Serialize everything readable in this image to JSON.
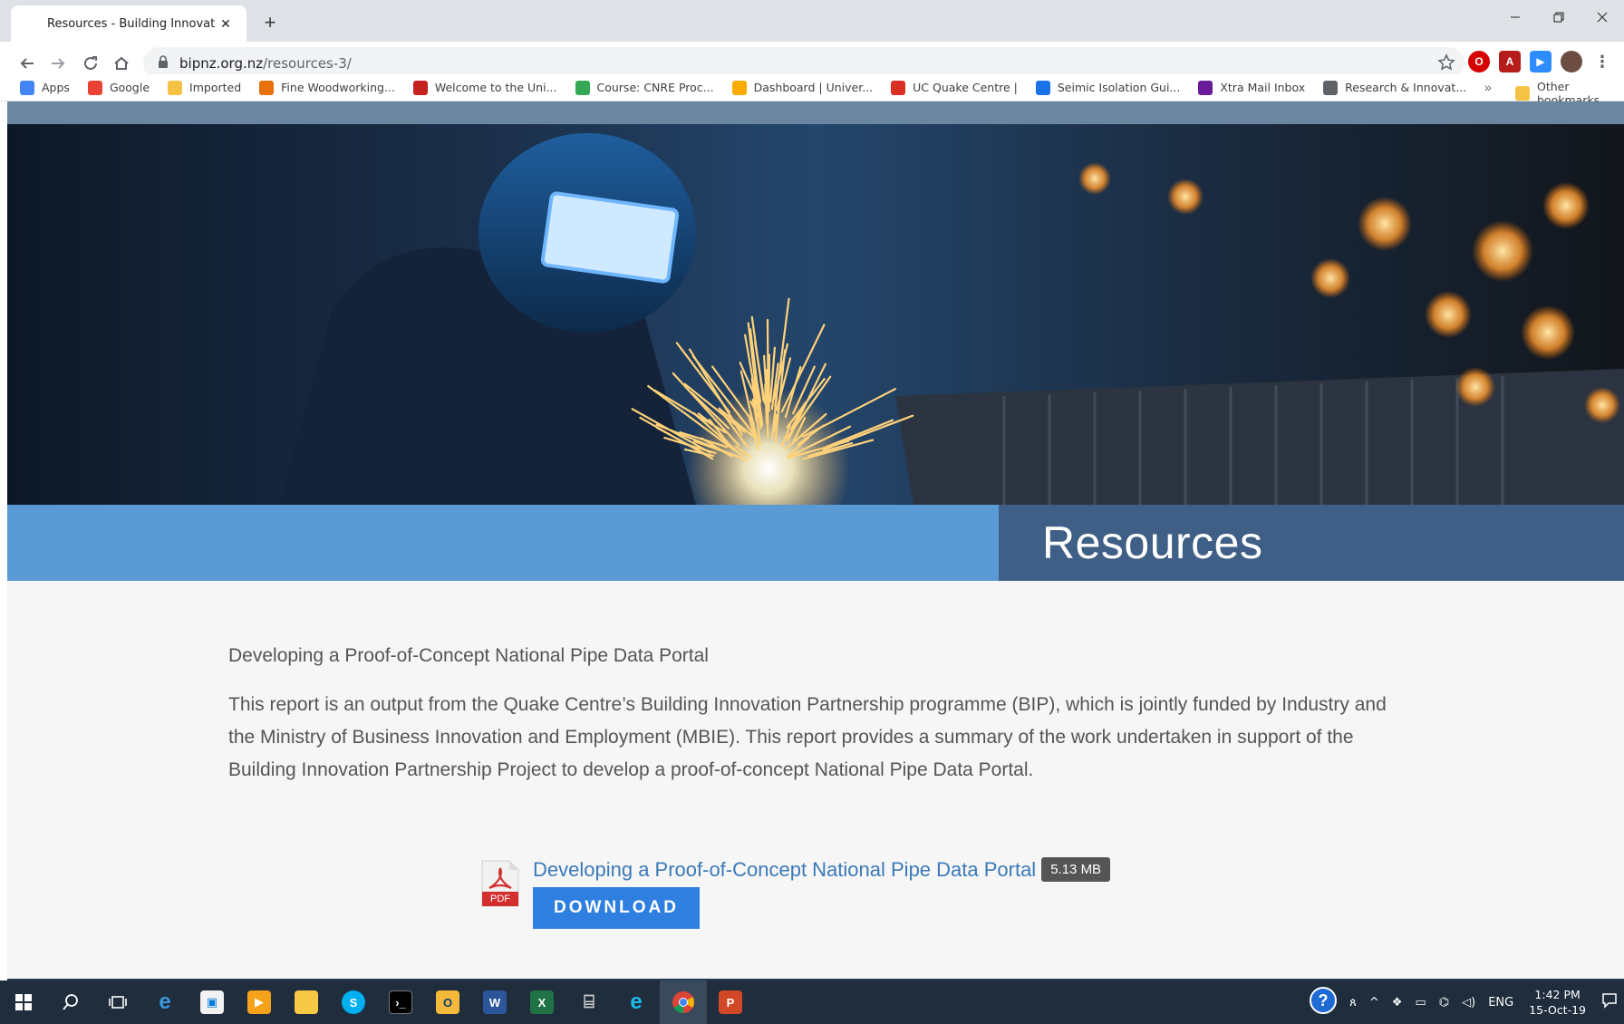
{
  "browser": {
    "tab_title": "Resources - Building Innovation P",
    "tab_close": "✕",
    "new_tab": "+",
    "url_host": "bipnz.org.nz",
    "url_path": "/resources-3/",
    "bookmarks_more": "»",
    "bookmarks": [
      {
        "label": "Apps",
        "color": "#4285f4"
      },
      {
        "label": "Google",
        "color": "#ea4335"
      },
      {
        "label": "Imported",
        "color": "#f6c244"
      },
      {
        "label": "Fine Woodworking...",
        "color": "#e8710a"
      },
      {
        "label": "Welcome to the Uni...",
        "color": "#c5221f"
      },
      {
        "label": "Course: CNRE Proc...",
        "color": "#34a853"
      },
      {
        "label": "Dashboard | Univer...",
        "color": "#f9ab00"
      },
      {
        "label": "UC Quake Centre |",
        "color": "#d93025"
      },
      {
        "label": "Seimic Isolation Gui...",
        "color": "#1a73e8"
      },
      {
        "label": "Xtra Mail Inbox",
        "color": "#6a1b9a"
      },
      {
        "label": "Research & Innovat...",
        "color": "#5f6368"
      }
    ],
    "other_bookmarks": "Other bookmarks"
  },
  "page": {
    "title": "Resources",
    "doc_heading": "Developing a Proof-of-Concept National Pipe Data Portal",
    "doc_description": "This report is an output from the Quake Centre’s Building Innovation Partnership programme (BIP), which is jointly funded by Industry and the Ministry of Business Innovation and Employment (MBIE). This report provides a summary of the work undertaken in support of the Building Innovation Partnership Project to develop a proof-of-concept National Pipe Data Portal.",
    "download": {
      "file_title": "Developing a Proof-of-Concept National Pipe Data Portal",
      "file_size": "5.13 MB",
      "button_label": "DOWNLOAD",
      "icon_label": "PDF"
    }
  },
  "taskbar": {
    "language": "ENG",
    "time": "1:42 PM",
    "date": "15-Oct-19"
  },
  "colors": {
    "banner_blue": "#5b9bd5",
    "banner_dark": "#3f5f86",
    "link_blue": "#3b79b8",
    "button_blue": "#2f7fe0"
  }
}
